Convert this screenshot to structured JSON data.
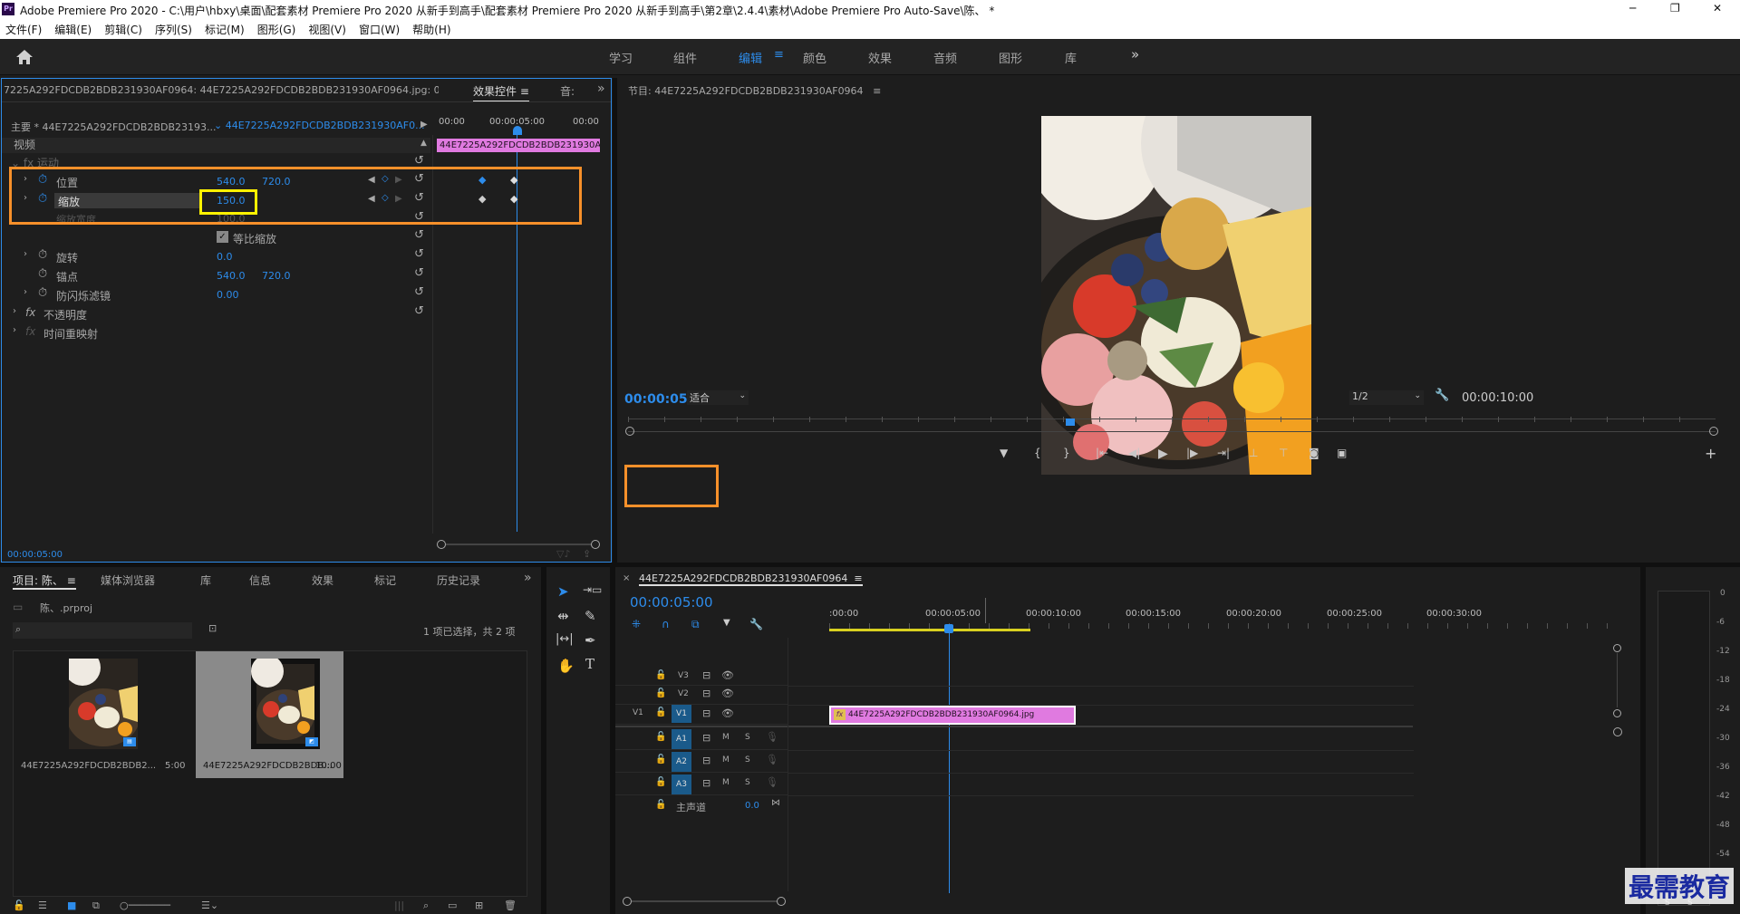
{
  "titlebar": {
    "app_icon": "Pr",
    "title": "Adobe Premiere Pro 2020 - C:\\用户\\hbxy\\桌面\\配套素材 Premiere Pro 2020 从新手到高手\\配套素材 Premiere Pro 2020 从新手到高手\\第2章\\2.4.4\\素材\\Adobe Premiere Pro Auto-Save\\陈、 *",
    "minimize": "─",
    "maximize": "❐",
    "close": "✕"
  },
  "menubar": [
    "文件(F)",
    "编辑(E)",
    "剪辑(C)",
    "序列(S)",
    "标记(M)",
    "图形(G)",
    "视图(V)",
    "窗口(W)",
    "帮助(H)"
  ],
  "workspaces": {
    "tabs": [
      "学习",
      "组件",
      "编辑",
      "颜色",
      "效果",
      "音频",
      "图形",
      "库"
    ],
    "active": 2,
    "more": "»"
  },
  "effect_controls": {
    "source_header": "7225A292FDCDB2BDB231930AF0964: 44E7225A292FDCDB2BDB231930AF0964.jpg: 00:00:00:00",
    "tab_label": "效果控件",
    "tab2": "音:",
    "expand": "»",
    "master_label": "主要 * 44E7225A292FDCDB2BDB23193...",
    "clip_select": "44E7225A292FDCDB2BDB231930AF0...",
    "mini_ruler": [
      "00:00",
      "00:00:05:00",
      "00:00"
    ],
    "mini_clip": "44E7225A292FDCDB2BDB231930A",
    "video_label": "视频",
    "motion_label": "运动",
    "props": [
      {
        "name": "位置",
        "v1": "540.0",
        "v2": "720.0"
      },
      {
        "name": "缩放",
        "v1": "150.0",
        "v2": ""
      },
      {
        "name": "缩放宽度",
        "v1": "100.0",
        "v2": ""
      },
      {
        "name": "等比缩放",
        "v1": "",
        "v2": ""
      },
      {
        "name": "旋转",
        "v1": "0.0",
        "v2": ""
      },
      {
        "name": "锚点",
        "v1": "540.0",
        "v2": "720.0"
      },
      {
        "name": "防闪烁滤镜",
        "v1": "0.00",
        "v2": ""
      }
    ],
    "opacity_label": "不透明度",
    "time_remap_label": "时间重映射",
    "timecode": "00:00:05:00"
  },
  "program": {
    "title": "节目: 44E7225A292FDCDB2BDB231930AF0964",
    "timecode": "00:00:05:00",
    "fit": "适合",
    "resolution": "1/2",
    "duration": "00:00:10:00",
    "playhead_fraction": 0.5
  },
  "project": {
    "tabs": [
      "项目: 陈、",
      "媒体浏览器",
      "库",
      "信息",
      "效果",
      "标记",
      "历史记录"
    ],
    "expand": "»",
    "file": "陈、.prproj",
    "status": "1 项已选择，共 2 项",
    "items": [
      {
        "name": "44E7225A292FDCDB2BDB2...",
        "duration": "5:00"
      },
      {
        "name": "44E7225A292FDCDB2BDB...",
        "duration": "10:00"
      }
    ]
  },
  "timeline": {
    "title": "44E7225A292FDCDB2BDB231930AF0964",
    "timecode": "00:00:05:00",
    "ruler": [
      ":00:00",
      "00:00:05:00",
      "00:00:10:00",
      "00:00:15:00",
      "00:00:20:00",
      "00:00:25:00",
      "00:00:30:00"
    ],
    "video_tracks": [
      "V3",
      "V2",
      "V1"
    ],
    "audio_tracks": [
      "A1",
      "A2",
      "A3"
    ],
    "source_patch": "V1",
    "mute": "M",
    "solo": "S",
    "master_label": "主声道",
    "master_value": "0.0",
    "clip": "44E7225A292FDCDB2BDB231930AF0964.jpg",
    "clip_fx": "fx"
  },
  "meter": {
    "scale": [
      "0",
      "-6",
      "-12",
      "-18",
      "-24",
      "-30",
      "-36",
      "-42",
      "-48",
      "-54"
    ],
    "bottom": [
      "S",
      "S"
    ]
  },
  "watermark": "最需教育",
  "colors": {
    "accent": "#2d8ceb",
    "clip": "#e07ae0",
    "orange": "#f7902a",
    "yellow": "#fff200"
  }
}
